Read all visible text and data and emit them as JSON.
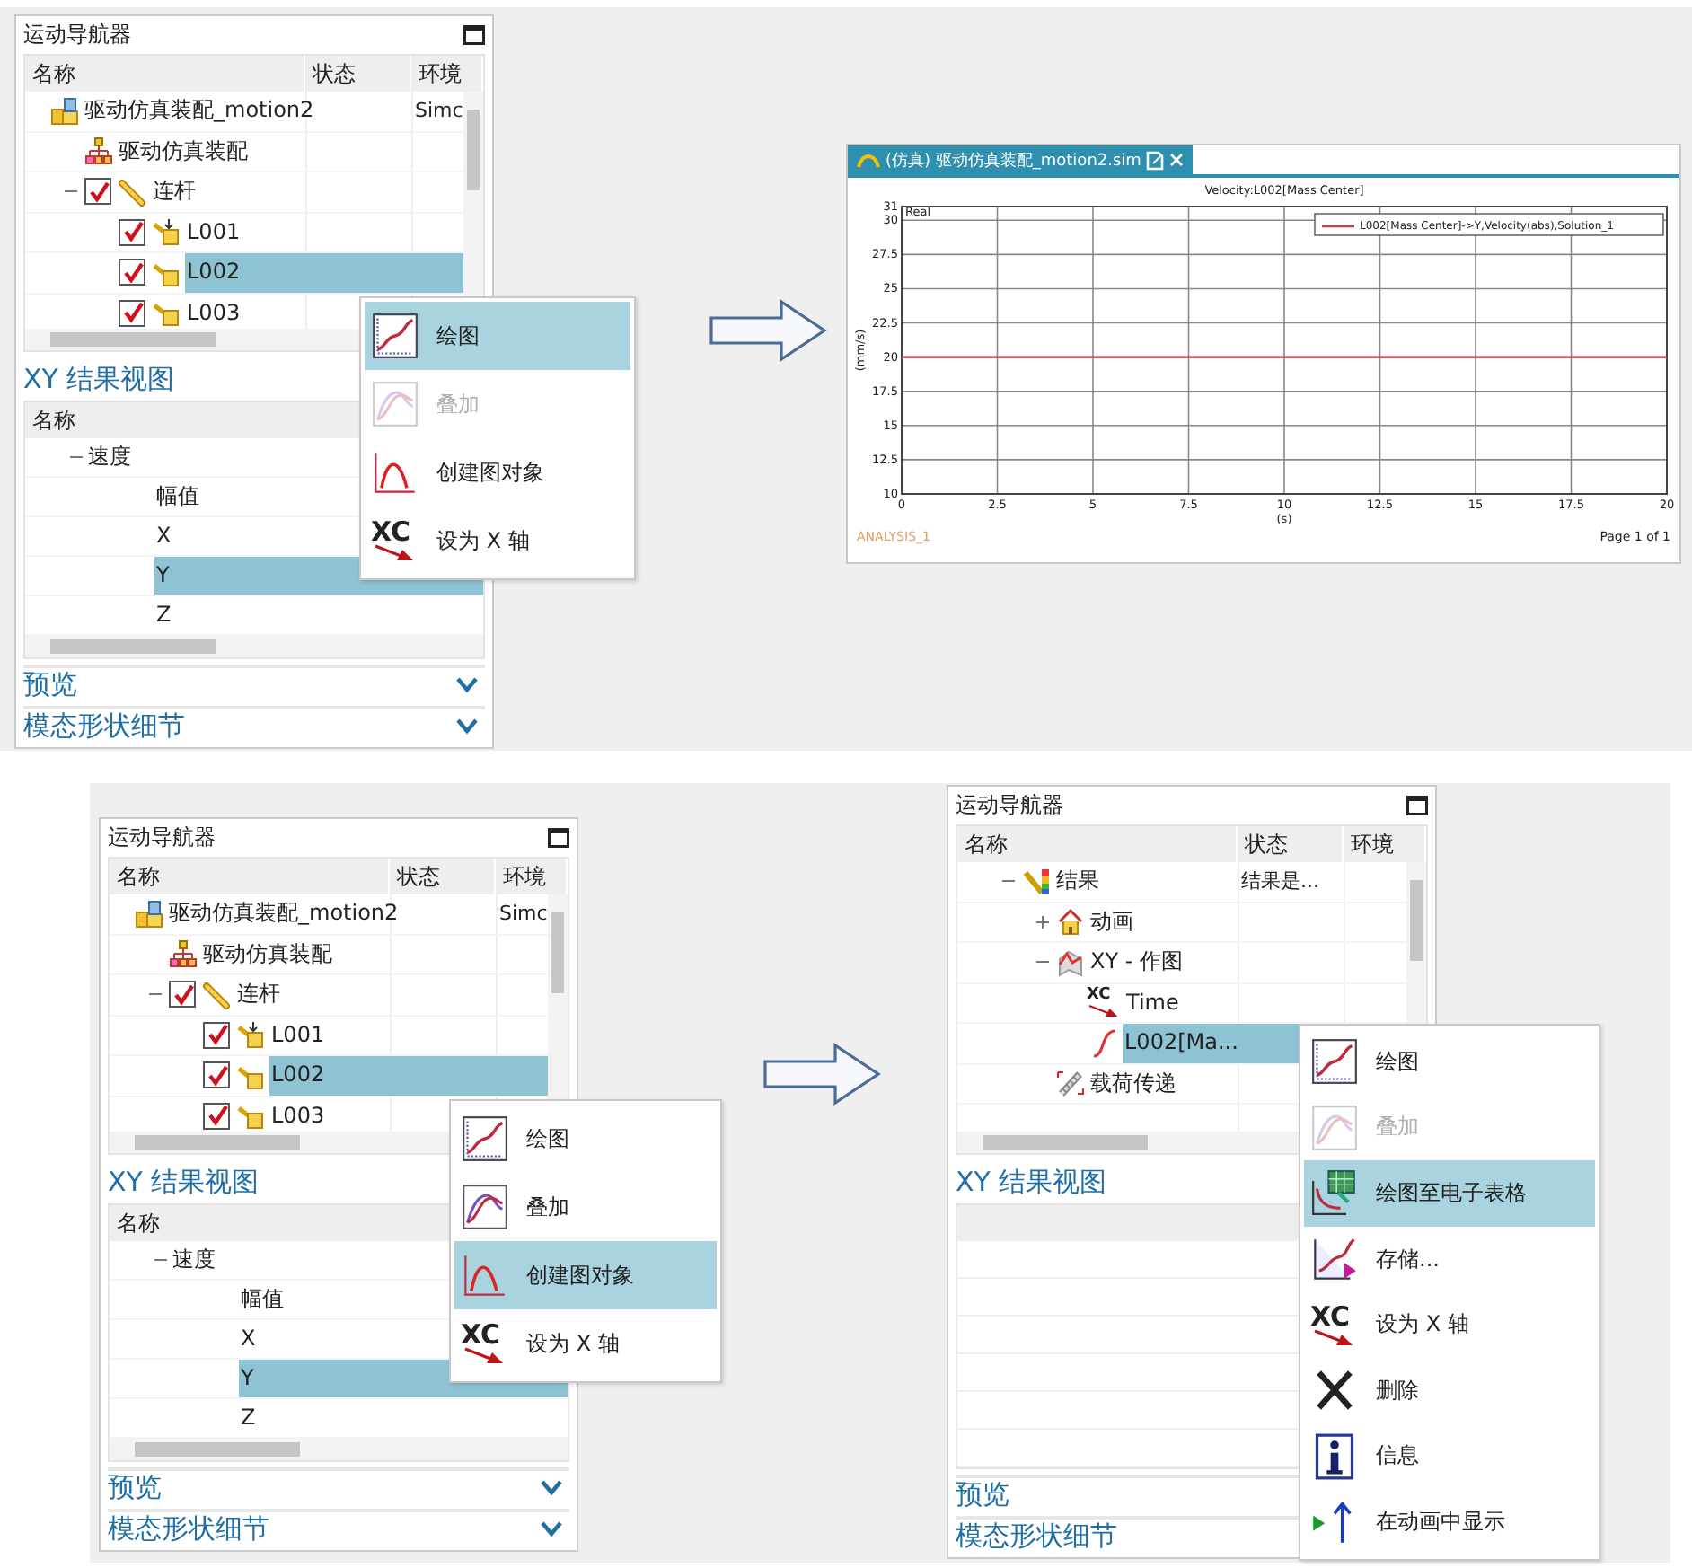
{
  "scenes": [
    {
      "navigator": {
        "title": "运动导航器",
        "columns": [
          "名称",
          "状态",
          "环境"
        ],
        "tree": [
          {
            "kind": "sim",
            "label": "驱动仿真装配_motion2",
            "env": "Simc",
            "selected": false,
            "children": [
              {
                "kind": "assembly",
                "label": "驱动仿真装配",
                "selected": false
              },
              {
                "kind": "links",
                "label": "连杆",
                "checked": true,
                "expanded": true,
                "selected": false,
                "children": [
                  {
                    "kind": "driver-link",
                    "label": "L001",
                    "checked": true,
                    "selected": false
                  },
                  {
                    "kind": "link",
                    "label": "L002",
                    "checked": true,
                    "selected": true
                  },
                  {
                    "kind": "link",
                    "label": "L003",
                    "checked": true,
                    "selected": false
                  }
                ]
              }
            ]
          }
        ],
        "xy_view": {
          "title": "XY 结果视图",
          "columns": [
            "名称"
          ],
          "tree": [
            {
              "label": "速度",
              "expanded": true,
              "selected": false,
              "children": [
                {
                  "label": "幅值",
                  "selected": false
                },
                {
                  "label": "X",
                  "selected": false
                },
                {
                  "label": "Y",
                  "selected": true
                },
                {
                  "label": "Z",
                  "selected": false
                }
              ]
            }
          ]
        },
        "sections": [
          {
            "title": "预览",
            "expanded": false
          },
          {
            "title": "模态形状细节",
            "expanded": false
          }
        ]
      },
      "menu": {
        "items": [
          {
            "kind": "plot",
            "label": "绘图",
            "selected": true,
            "disabled": false
          },
          {
            "kind": "overlay",
            "label": "叠加",
            "selected": false,
            "disabled": true
          },
          {
            "kind": "create",
            "label": "创建图对象",
            "selected": false,
            "disabled": false
          },
          {
            "kind": "set-x",
            "label": "设为 X 轴",
            "icon_text": "XC",
            "selected": false,
            "disabled": false
          }
        ]
      },
      "result": {
        "kind": "chart",
        "tab": {
          "label": "(仿真) 驱动仿真装配_motion2.sim",
          "selected": true
        },
        "chart_data": {
          "type": "line",
          "title": "Velocity:L002[Mass Center]",
          "xlabel": "(s)",
          "ylabel": "(mm/s)",
          "x": [
            0,
            20
          ],
          "series": [
            {
              "name": "L002[Mass Center]->Y,Velocity(abs),Solution_1",
              "color": "#c0404a",
              "values": [
                20,
                20
              ]
            }
          ],
          "xlim": [
            0,
            20
          ],
          "ylim": [
            10,
            31
          ],
          "grid": true,
          "xticks": [
            0,
            2.5,
            5,
            7.5,
            10,
            12.5,
            15,
            17.5,
            20
          ],
          "yticks": [
            10,
            12.5,
            15,
            17.5,
            20,
            22.5,
            25,
            27.5,
            30,
            31
          ],
          "annotations": [
            "Real"
          ]
        },
        "footer": "ANALYSIS_1",
        "page": "Page 1 of 1"
      }
    },
    {
      "navigator": {
        "title": "运动导航器",
        "columns": [
          "名称",
          "状态",
          "环境"
        ],
        "tree": [
          {
            "kind": "sim",
            "label": "驱动仿真装配_motion2",
            "env": "Simc",
            "selected": false,
            "children": [
              {
                "kind": "assembly",
                "label": "驱动仿真装配",
                "selected": false
              },
              {
                "kind": "links",
                "label": "连杆",
                "checked": true,
                "expanded": true,
                "selected": false,
                "children": [
                  {
                    "kind": "driver-link",
                    "label": "L001",
                    "checked": true,
                    "selected": false
                  },
                  {
                    "kind": "link",
                    "label": "L002",
                    "checked": true,
                    "selected": true
                  },
                  {
                    "kind": "link",
                    "label": "L003",
                    "checked": true,
                    "selected": false
                  }
                ]
              }
            ]
          }
        ],
        "xy_view": {
          "title": "XY 结果视图",
          "columns": [
            "名称"
          ],
          "tree": [
            {
              "label": "速度",
              "expanded": true,
              "selected": false,
              "children": [
                {
                  "label": "幅值",
                  "selected": false
                },
                {
                  "label": "X",
                  "selected": false
                },
                {
                  "label": "Y",
                  "selected": true
                },
                {
                  "label": "Z",
                  "selected": false
                }
              ]
            }
          ]
        },
        "sections": [
          {
            "title": "预览",
            "expanded": false
          },
          {
            "title": "模态形状细节",
            "expanded": false
          }
        ]
      },
      "menu": {
        "items": [
          {
            "kind": "plot",
            "label": "绘图",
            "selected": false,
            "disabled": false
          },
          {
            "kind": "overlay",
            "label": "叠加",
            "selected": false,
            "disabled": false
          },
          {
            "kind": "create",
            "label": "创建图对象",
            "selected": true,
            "disabled": false
          },
          {
            "kind": "set-x",
            "label": "设为 X 轴",
            "icon_text": "XC",
            "selected": false,
            "disabled": false
          }
        ]
      },
      "result": {
        "kind": "navigator",
        "navigator": {
          "title": "运动导航器",
          "columns": [
            "名称",
            "状态",
            "环境"
          ],
          "tree": [
            {
              "kind": "results",
              "label": "结果",
              "status": "结果是...",
              "expanded": true,
              "selected": false,
              "children": [
                {
                  "kind": "animation",
                  "label": "动画",
                  "expanded": false,
                  "selected": false
                },
                {
                  "kind": "xy-plot",
                  "label": "XY - 作图",
                  "expanded": true,
                  "selected": false,
                  "children": [
                    {
                      "kind": "axis",
                      "label": "Time",
                      "icon_text": "XC",
                      "selected": false
                    },
                    {
                      "kind": "curve",
                      "label": "L002[Ma...",
                      "selected": true
                    }
                  ]
                },
                {
                  "kind": "load",
                  "label": "载荷传递",
                  "selected": false
                }
              ]
            }
          ],
          "xy_view": {
            "title": "XY 结果视图"
          },
          "sections": [
            {
              "title": "预览"
            },
            {
              "title": "模态形状细节"
            }
          ]
        },
        "menu": {
          "items": [
            {
              "kind": "plot",
              "label": "绘图",
              "selected": false,
              "disabled": false
            },
            {
              "kind": "overlay",
              "label": "叠加",
              "selected": false,
              "disabled": true
            },
            {
              "kind": "spreadsheet",
              "label": "绘图至电子表格",
              "selected": true,
              "disabled": false
            },
            {
              "kind": "store",
              "label": "存储...",
              "selected": false,
              "disabled": false
            },
            {
              "kind": "set-x",
              "label": "设为 X 轴",
              "icon_text": "XC",
              "selected": false,
              "disabled": false
            },
            {
              "kind": "delete",
              "label": "删除",
              "selected": false,
              "disabled": false
            },
            {
              "kind": "info",
              "label": "信息",
              "selected": false,
              "disabled": false
            },
            {
              "kind": "animate",
              "label": "在动画中显示",
              "selected": false,
              "disabled": false
            }
          ]
        }
      }
    }
  ]
}
